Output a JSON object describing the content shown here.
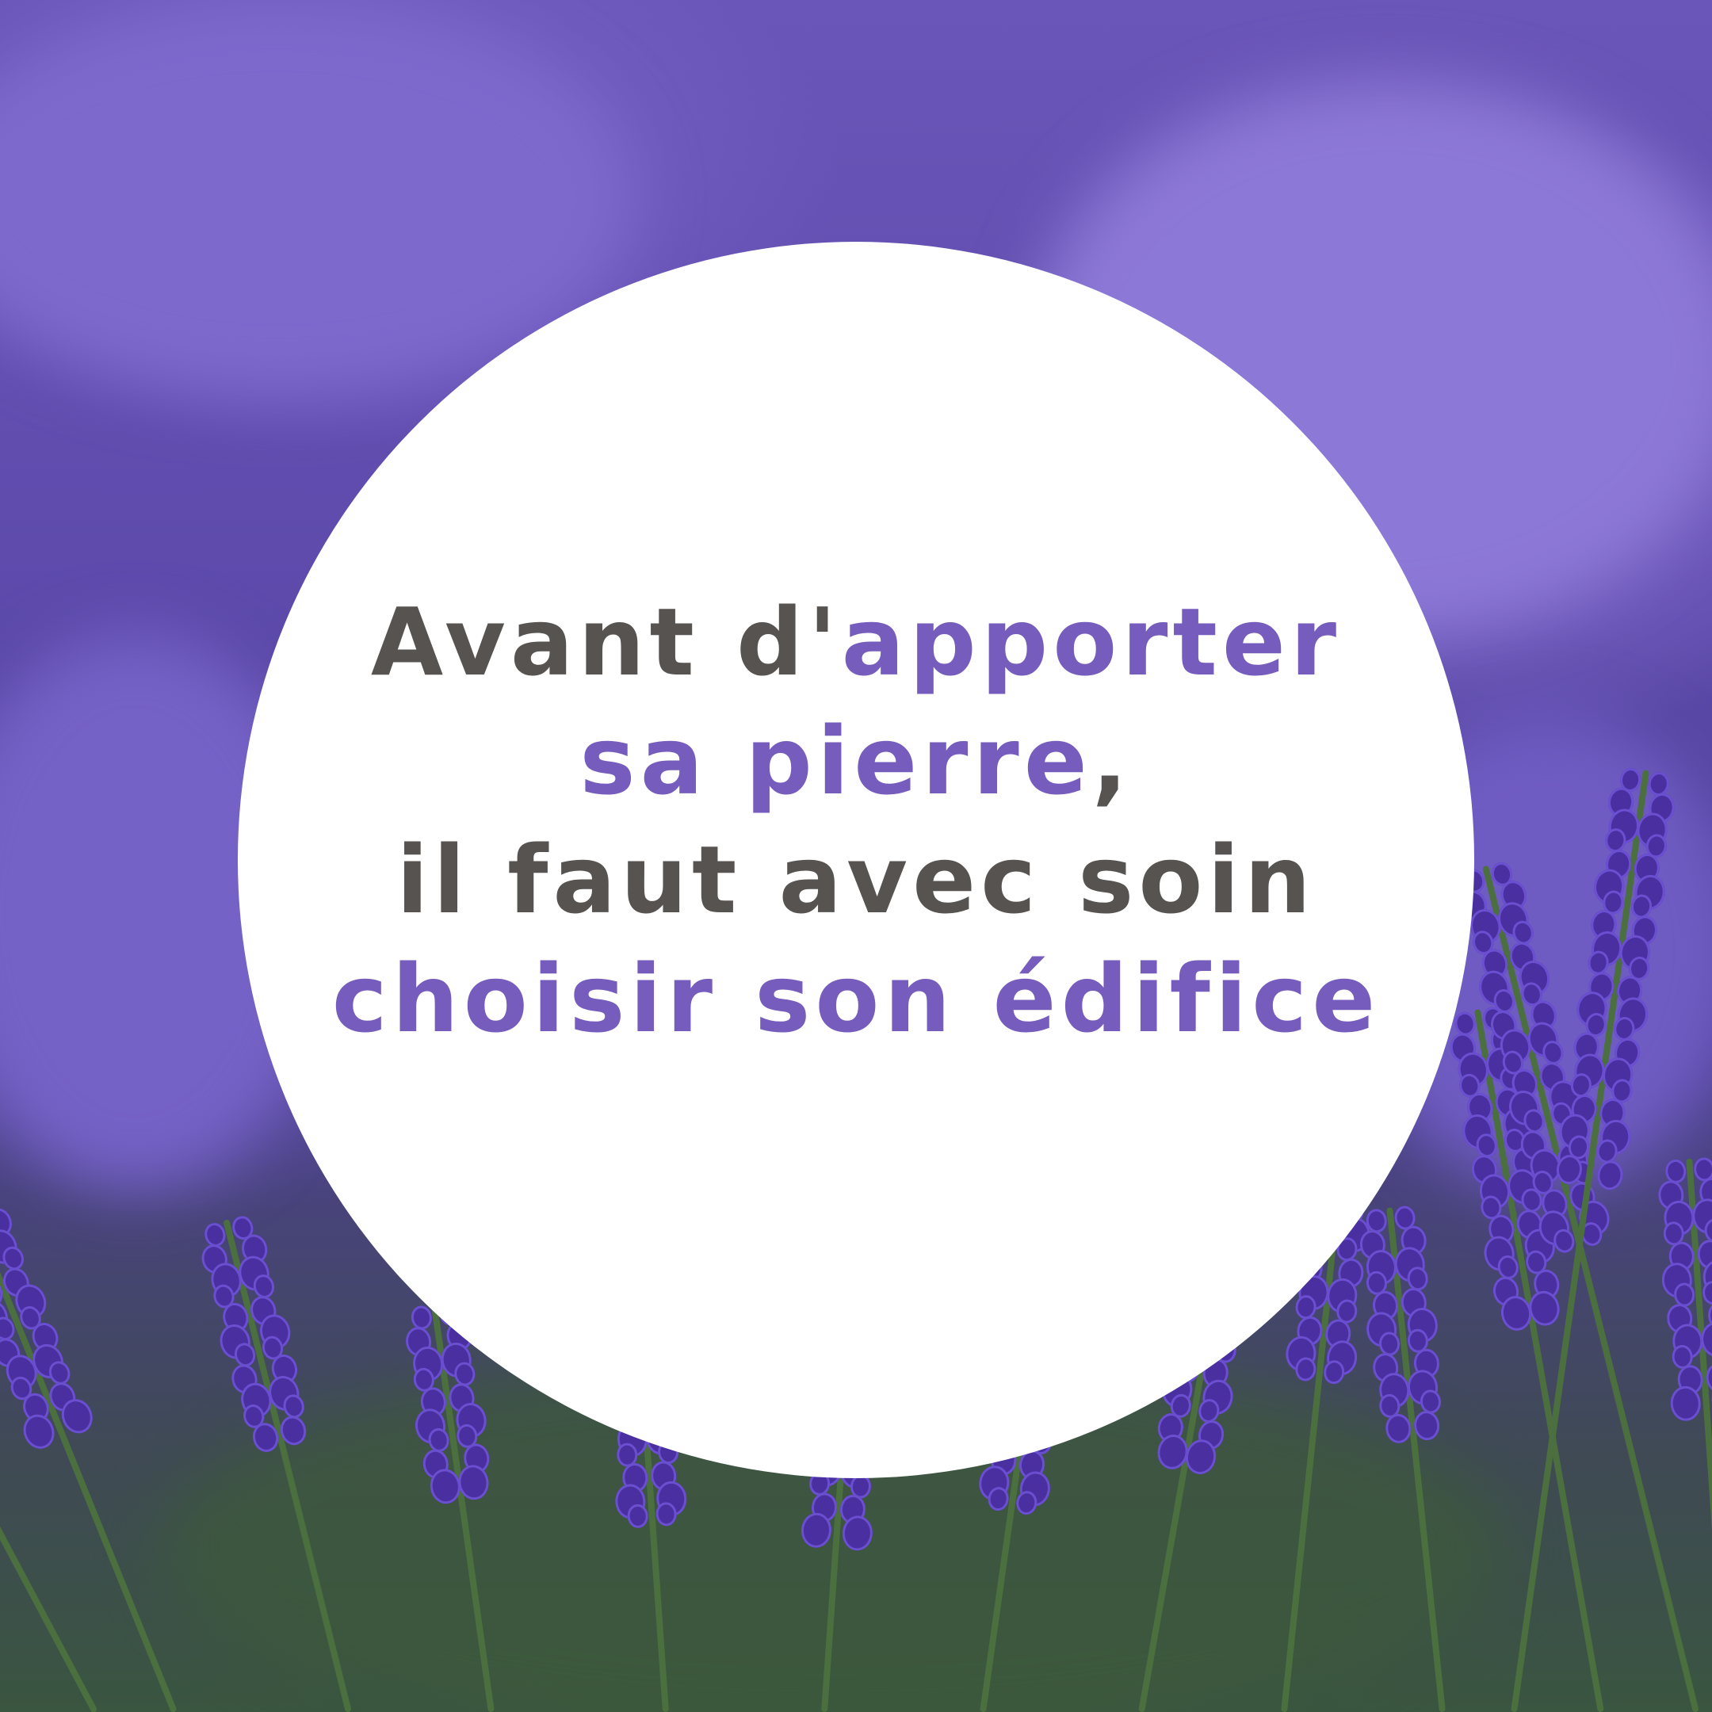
{
  "quote": {
    "line1_plain": "Avant d'",
    "line1_accent": "apporter",
    "line2_accent": "sa pierre",
    "line2_plain": ",",
    "line3_plain": "il faut avec soin",
    "line4_accent": "choisir son édifice"
  },
  "colors": {
    "text_dark": "#565351",
    "text_accent": "#765cbc",
    "circle_fill": "#ffffff",
    "lavender": "#5a45a8"
  },
  "background": {
    "subject": "lavender-field-photo"
  }
}
